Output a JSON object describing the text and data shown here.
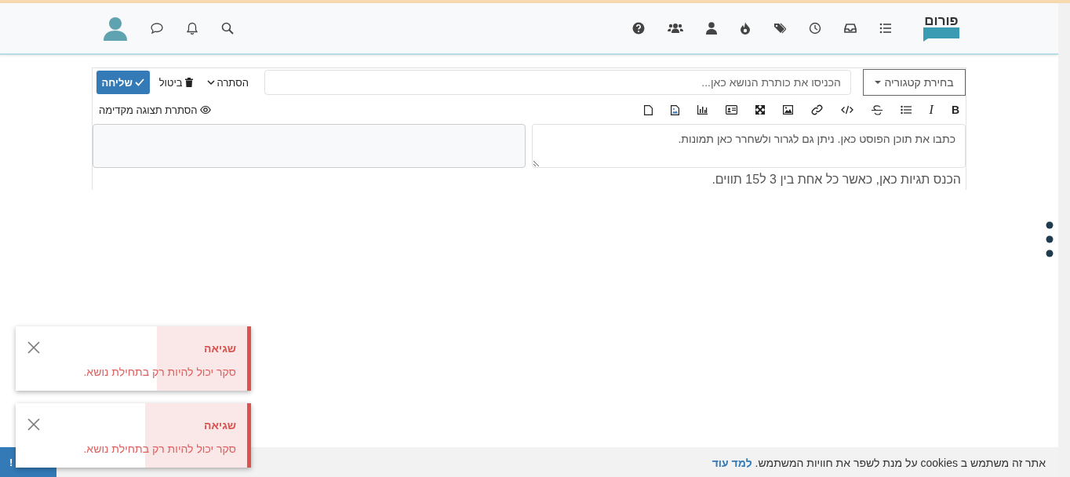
{
  "header": {
    "logo_text": "פורום"
  },
  "composer": {
    "category_button": "בחירת קטגוריה",
    "title_placeholder": "הכניסו את כותרת הנושא כאן...",
    "hide_dropdown": "הסתרה",
    "cancel_button": "ביטול",
    "submit_button": "שליחה",
    "toolbar": {
      "bold_label": "B",
      "italic_label": "I"
    },
    "preview_toggle": "הסתרת תצוגה מקדימה",
    "body_placeholder": "כתבו את תוכן הפוסט כאן. ניתן גם לגרור ולשחרר כאן תמונות.",
    "tags_placeholder": "הכנס תגיות כאן, כאשר כל אחת בין 3 ל15 תווים."
  },
  "toasts": [
    {
      "title": "שגיאה",
      "message": "סקר יכול להיות רק בתחילת נושא.",
      "level": 0.39
    },
    {
      "title": "שגיאה",
      "message": "סקר יכול להיות רק בתחילת נושא.",
      "level": 0.44
    }
  ],
  "cookie_bar": {
    "message": "אתר זה משתמש ב cookies על מנת לשפר את חוויות המשתמש.",
    "link": "למד עוד",
    "button": "!"
  }
}
